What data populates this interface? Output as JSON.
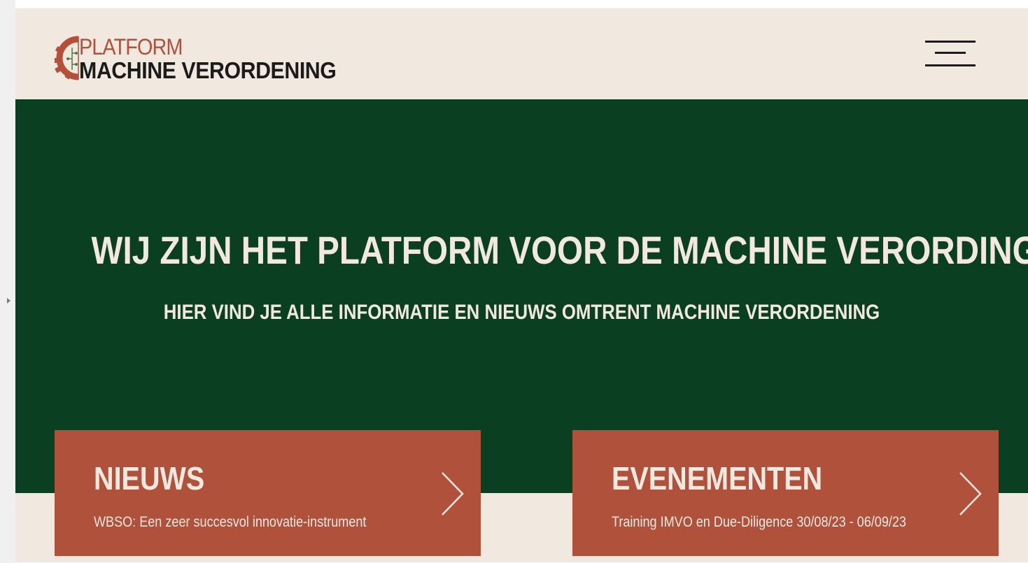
{
  "logo": {
    "line1": "PLATFORM",
    "line2": "MACHINE VERORDENING"
  },
  "header": {
    "menu_icon": "hamburger-icon"
  },
  "hero": {
    "title": "WIJ ZIJN HET PLATFORM VOOR DE MACHINE VERORDING",
    "subtitle": "HIER VIND JE ALLE INFORMATIE EN NIEUWS OMTRENT MACHINE VERORDENING"
  },
  "cards": [
    {
      "title": "NIEUWS",
      "text": "WBSO: Een zeer succesvol innovatie-instrument",
      "icon": "chevron-right-icon"
    },
    {
      "title": "EVENEMENTEN",
      "text": "Training IMVO en Due-Diligence 30/08/23 - 06/09/23",
      "icon": "chevron-right-icon"
    }
  ],
  "colors": {
    "background": "#f1e8e0",
    "hero": "#0a3f22",
    "accent": "#b0513c",
    "text_light": "#f1e8e0",
    "text_dark": "#1b1b1b"
  }
}
